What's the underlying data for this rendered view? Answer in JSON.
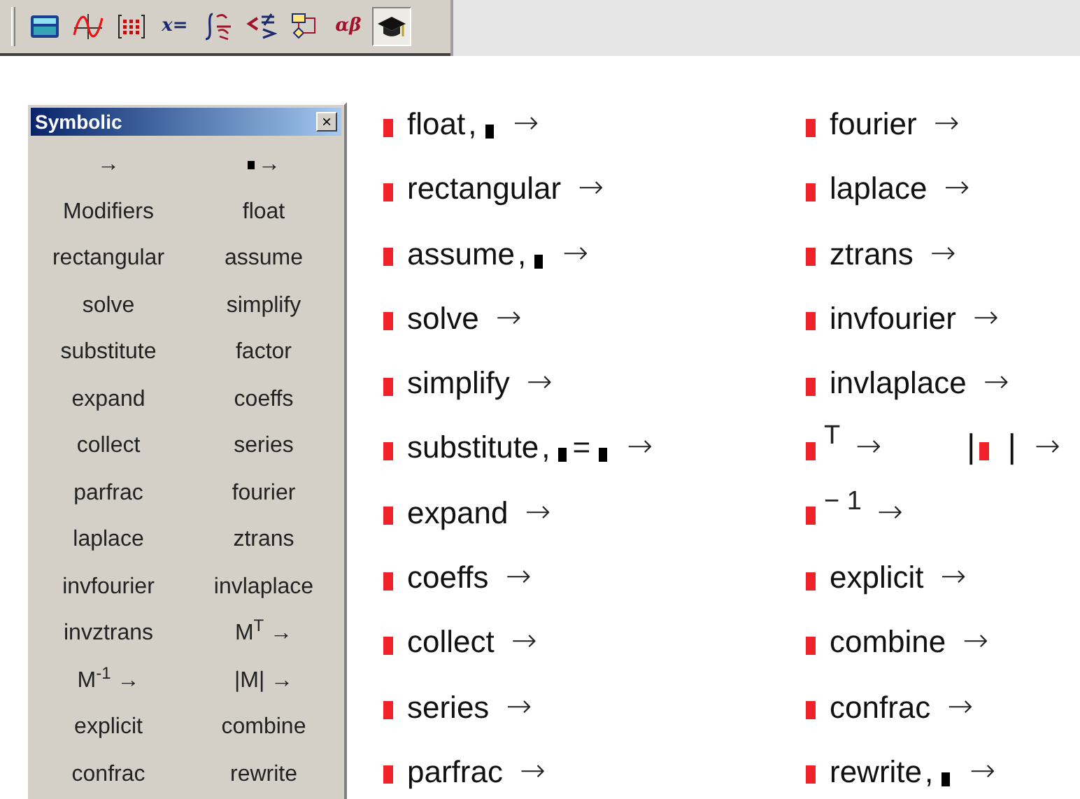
{
  "toolbar": [
    {
      "kind": "calculator",
      "selected": false
    },
    {
      "kind": "graph",
      "selected": false
    },
    {
      "kind": "matrix",
      "selected": false
    },
    {
      "kind": "evaluation",
      "label": "x=",
      "selected": false
    },
    {
      "kind": "calculus",
      "selected": false
    },
    {
      "kind": "boolean",
      "selected": false
    },
    {
      "kind": "programming",
      "selected": false
    },
    {
      "kind": "greek",
      "label": "αβ",
      "selected": false
    },
    {
      "kind": "symbolic",
      "selected": true
    }
  ],
  "palette": {
    "title": "Symbolic",
    "close": "×",
    "buttons": [
      {
        "label": "→",
        "slot": false
      },
      {
        "label": "→",
        "slot": true
      },
      {
        "label": "Modifiers",
        "slot": false
      },
      {
        "label": "float",
        "slot": false
      },
      {
        "label": "rectangular",
        "slot": false
      },
      {
        "label": "assume",
        "slot": false
      },
      {
        "label": "solve",
        "slot": false
      },
      {
        "label": "simplify",
        "slot": false
      },
      {
        "label": "substitute",
        "slot": false
      },
      {
        "label": "factor",
        "slot": false
      },
      {
        "label": "expand",
        "slot": false
      },
      {
        "label": "coeffs",
        "slot": false
      },
      {
        "label": "collect",
        "slot": false
      },
      {
        "label": "series",
        "slot": false
      },
      {
        "label": "parfrac",
        "slot": false
      },
      {
        "label": "fourier",
        "slot": false
      },
      {
        "label": "laplace",
        "slot": false
      },
      {
        "label": "ztrans",
        "slot": false
      },
      {
        "label": "invfourier",
        "slot": false
      },
      {
        "label": "invlaplace",
        "slot": false
      },
      {
        "label": "invztrans",
        "slot": false
      },
      {
        "label": "M$^{T}$ →",
        "slot": false
      },
      {
        "label": "M$^{-1}$ →",
        "slot": false
      },
      {
        "label": "|M| →",
        "slot": false
      },
      {
        "label": "explicit",
        "slot": false
      },
      {
        "label": "combine",
        "slot": false
      },
      {
        "label": "confrac",
        "slot": false
      },
      {
        "label": "rewrite",
        "slot": false
      }
    ]
  },
  "columns": [
    [
      {
        "items": [
          [
            {
              "kind": "ph"
            },
            {
              "kind": "text",
              "text": "float"
            },
            {
              "kind": "text",
              "text": ","
            },
            {
              "kind": "slot"
            },
            {
              "kind": "arrow",
              "text": "→"
            }
          ]
        ]
      },
      {
        "items": [
          [
            {
              "kind": "ph"
            },
            {
              "kind": "text",
              "text": "rectangular"
            },
            {
              "kind": "arrow",
              "text": "→"
            }
          ]
        ]
      },
      {
        "items": [
          [
            {
              "kind": "ph"
            },
            {
              "kind": "text",
              "text": "assume"
            },
            {
              "kind": "text",
              "text": ","
            },
            {
              "kind": "slot"
            },
            {
              "kind": "arrow",
              "text": "→"
            }
          ]
        ]
      },
      {
        "items": [
          [
            {
              "kind": "ph"
            },
            {
              "kind": "text",
              "text": "solve"
            },
            {
              "kind": "arrow",
              "text": "→"
            }
          ]
        ]
      },
      {
        "items": [
          [
            {
              "kind": "ph"
            },
            {
              "kind": "text",
              "text": "simplify"
            },
            {
              "kind": "arrow",
              "text": "→"
            }
          ]
        ]
      },
      {
        "items": [
          [
            {
              "kind": "ph"
            },
            {
              "kind": "text",
              "text": "substitute"
            },
            {
              "kind": "text",
              "text": ","
            },
            {
              "kind": "slot"
            },
            {
              "kind": "text",
              "text": "="
            },
            {
              "kind": "slot"
            },
            {
              "kind": "arrow",
              "text": "→"
            }
          ]
        ]
      },
      {
        "items": [
          [
            {
              "kind": "ph"
            },
            {
              "kind": "text",
              "text": "expand"
            },
            {
              "kind": "arrow",
              "text": "→"
            }
          ]
        ]
      },
      {
        "items": [
          [
            {
              "kind": "ph"
            },
            {
              "kind": "text",
              "text": "coeffs"
            },
            {
              "kind": "arrow",
              "text": "→"
            }
          ]
        ]
      },
      {
        "items": [
          [
            {
              "kind": "ph"
            },
            {
              "kind": "text",
              "text": "collect"
            },
            {
              "kind": "arrow",
              "text": "→"
            }
          ]
        ]
      },
      {
        "items": [
          [
            {
              "kind": "ph"
            },
            {
              "kind": "text",
              "text": "series"
            },
            {
              "kind": "arrow",
              "text": "→"
            }
          ]
        ]
      },
      {
        "items": [
          [
            {
              "kind": "ph"
            },
            {
              "kind": "text",
              "text": "parfrac"
            },
            {
              "kind": "arrow",
              "text": "→"
            }
          ]
        ]
      }
    ],
    [
      {
        "items": [
          [
            {
              "kind": "ph"
            },
            {
              "kind": "text",
              "text": "fourier"
            },
            {
              "kind": "arrow",
              "text": "→"
            }
          ]
        ]
      },
      {
        "items": [
          [
            {
              "kind": "ph"
            },
            {
              "kind": "text",
              "text": "laplace"
            },
            {
              "kind": "arrow",
              "text": "→"
            }
          ]
        ]
      },
      {
        "items": [
          [
            {
              "kind": "ph"
            },
            {
              "kind": "text",
              "text": "ztrans"
            },
            {
              "kind": "arrow",
              "text": "→"
            }
          ]
        ]
      },
      {
        "items": [
          [
            {
              "kind": "ph"
            },
            {
              "kind": "text",
              "text": "invfourier"
            },
            {
              "kind": "arrow",
              "text": "→"
            }
          ]
        ]
      },
      {
        "items": [
          [
            {
              "kind": "ph"
            },
            {
              "kind": "text",
              "text": "invlaplace"
            },
            {
              "kind": "arrow",
              "text": "→"
            }
          ]
        ]
      },
      {
        "items": [
          [
            {
              "kind": "ph"
            },
            {
              "kind": "sup",
              "text": "T"
            },
            {
              "kind": "arrow",
              "text": "→"
            }
          ],
          [
            {
              "kind": "bar",
              "text": "|"
            },
            {
              "kind": "ph"
            },
            {
              "kind": "bar",
              "text": "|"
            },
            {
              "kind": "arrow",
              "text": "→"
            }
          ]
        ]
      },
      {
        "items": [
          [
            {
              "kind": "ph"
            },
            {
              "kind": "sup",
              "text": "− 1"
            },
            {
              "kind": "arrow",
              "text": "→"
            }
          ]
        ]
      },
      {
        "items": [
          [
            {
              "kind": "ph"
            },
            {
              "kind": "text",
              "text": "explicit"
            },
            {
              "kind": "arrow",
              "text": "→"
            }
          ]
        ]
      },
      {
        "items": [
          [
            {
              "kind": "ph"
            },
            {
              "kind": "text",
              "text": "combine"
            },
            {
              "kind": "arrow",
              "text": "→"
            }
          ]
        ]
      },
      {
        "items": [
          [
            {
              "kind": "ph"
            },
            {
              "kind": "text",
              "text": "confrac"
            },
            {
              "kind": "arrow",
              "text": "→"
            }
          ]
        ]
      },
      {
        "items": [
          [
            {
              "kind": "ph"
            },
            {
              "kind": "text",
              "text": "rewrite"
            },
            {
              "kind": "text",
              "text": ","
            },
            {
              "kind": "slot"
            },
            {
              "kind": "arrow",
              "text": "→"
            }
          ]
        ]
      }
    ]
  ]
}
